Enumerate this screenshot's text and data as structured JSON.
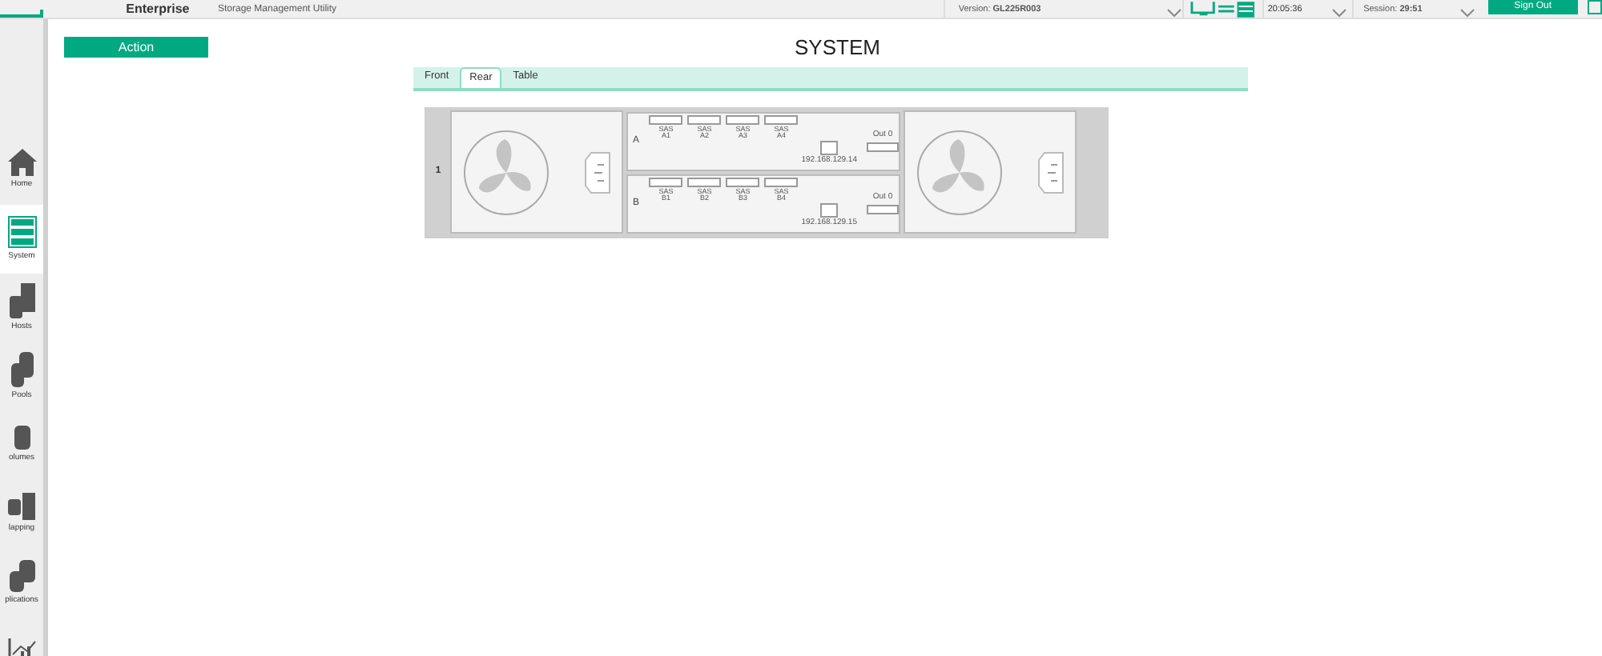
{
  "header": {
    "brand": "Enterprise",
    "subtitle": "Storage Management Utility",
    "version_label": "Version:",
    "version": "GL225R003",
    "time": "20:05:36",
    "session_label": "Session:",
    "session": "29:51",
    "sign_out": "Sign Out"
  },
  "sidebar": {
    "items": [
      {
        "label": "Home",
        "kind": "home",
        "selected": false
      },
      {
        "label": "System",
        "kind": "system",
        "selected": true
      },
      {
        "label": "Hosts",
        "kind": "hosts",
        "selected": false
      },
      {
        "label": "Pools",
        "kind": "pools",
        "selected": false
      },
      {
        "label": "olumes",
        "kind": "volumes",
        "selected": false
      },
      {
        "label": "lapping",
        "kind": "mapping",
        "selected": false
      },
      {
        "label": "plications",
        "kind": "replications",
        "selected": false
      },
      {
        "kind": "performance",
        "selected": false
      }
    ]
  },
  "action_button": "Action",
  "title": "SYSTEM",
  "tabs": [
    {
      "label": "Front",
      "selected": false
    },
    {
      "label": "Rear",
      "selected": true
    },
    {
      "label": "Table",
      "selected": false
    }
  ],
  "enclosure": {
    "number": "1",
    "controllers": [
      {
        "name": "A",
        "ports": [
          {
            "type": "SAS",
            "label": "A1"
          },
          {
            "type": "SAS",
            "label": "A2"
          },
          {
            "type": "SAS",
            "label": "A3"
          },
          {
            "type": "SAS",
            "label": "A4"
          }
        ],
        "ip": "192.168.129.14",
        "out_label": "Out 0"
      },
      {
        "name": "B",
        "ports": [
          {
            "type": "SAS",
            "label": "B1"
          },
          {
            "type": "SAS",
            "label": "B2"
          },
          {
            "type": "SAS",
            "label": "B3"
          },
          {
            "type": "SAS",
            "label": "B4"
          }
        ],
        "ip": "192.168.129.15",
        "out_label": "Out 0"
      }
    ]
  }
}
